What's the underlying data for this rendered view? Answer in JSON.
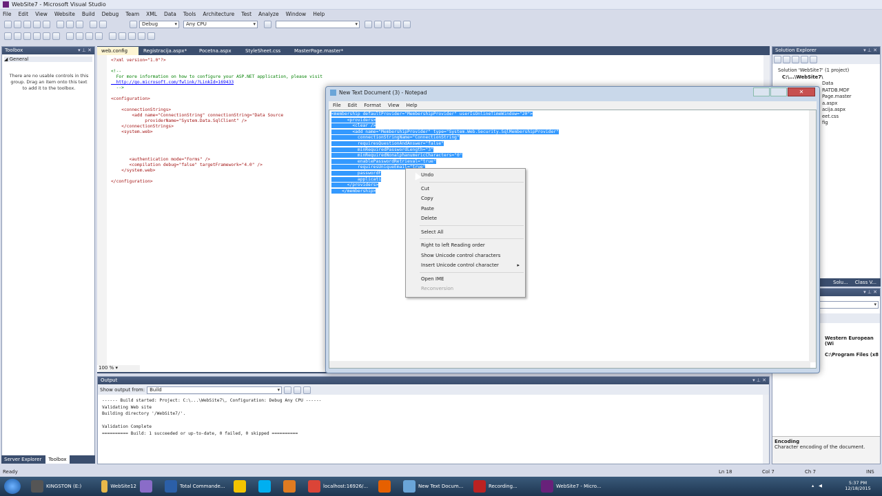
{
  "window": {
    "title": "WebSite7 - Microsoft Visual Studio"
  },
  "menu": [
    "File",
    "Edit",
    "View",
    "Website",
    "Build",
    "Debug",
    "Team",
    "XML",
    "Data",
    "Tools",
    "Architecture",
    "Test",
    "Analyze",
    "Window",
    "Help"
  ],
  "toolbar": {
    "config": "Debug",
    "platform": "Any CPU",
    "search": ""
  },
  "toolbox": {
    "title": "Toolbox",
    "group": "General",
    "empty_text": "There are no usable controls in this group. Drag an item onto this text to add it to the toolbox.",
    "tabs": [
      "Server Explorer",
      "Toolbox"
    ]
  },
  "editor": {
    "tabs": [
      "web.config",
      "Registracija.aspx*",
      "Pocetna.aspx",
      "StyleSheet.css",
      "MasterPage.master*"
    ],
    "lines": [
      "<?xml version=\"1.0\"?>",
      "",
      "<!--",
      "  For more information on how to configure your ASP.NET application, please visit",
      "  http://go.microsoft.com/fwlink/?LinkId=169433",
      "  -->",
      "",
      "<configuration>",
      "",
      "    <connectionStrings>",
      "        <add name=\"ConnectionString\" connectionString=\"Data Source",
      "             providerName=\"System.Data.SqlClient\" />",
      "    </connectionStrings>",
      "    <system.web>",
      "",
      "",
      "",
      "",
      "       <authentication mode=\"Forms\" />",
      "       <compilation debug=\"false\" targetFramework=\"4.0\" />",
      "    </system.web>",
      "",
      "</configuration>"
    ],
    "zoom": "100 %"
  },
  "solution": {
    "title": "Solution Explorer",
    "root": "Solution 'WebSite7' (1 project)",
    "project": "C:\\...\\WebSite7\\",
    "items": [
      "Data",
      "RATDB.MDF",
      "Page.master",
      "a.aspx",
      "acija.aspx",
      "eet.css",
      "fig"
    ],
    "tabs": [
      "Solu...",
      "Class V..."
    ]
  },
  "properties": {
    "encoding_label": "Western European (Wi",
    "path_label": "C:\\Program Files (x8",
    "desc_title": "Encoding",
    "desc_text": "Character encoding of the document."
  },
  "output": {
    "title": "Output",
    "show_label": "Show output from:",
    "source": "Build",
    "lines": [
      "------ Build started: Project: C:\\...\\WebSite7\\, Configuration: Debug Any CPU ------",
      "Validating Web site",
      "Building directory '/WebSite7/'.",
      "",
      "Validation Complete",
      "========== Build: 1 succeeded or up-to-date, 0 failed, 0 skipped =========="
    ]
  },
  "notepad": {
    "title": "New Text Document (3) - Notepad",
    "menu": [
      "File",
      "Edit",
      "Format",
      "View",
      "Help"
    ],
    "lines": [
      "<membership defaultProvider=\"MembershipProvider\" userIsOnlineTimeWindow=\"20\">",
      "      <providers>",
      "        <clear />",
      "        <add name=\"MembershipProvider\" type=\"System.Web.Security.SqlMembershipProvider\"",
      "          connectionStringName=\"ConnectionString\"",
      "          requiresQuestionAndAnswer=\"false\"",
      "          minRequiredPasswordLength=\"3\"",
      "          minRequiredNonalphanumericCharacters=\"0\"",
      "          enablePasswordRetrieval=\"true\"",
      "          requiresUniqueEmail=\"true\"",
      "          passwordF",
      "          applicati",
      "      </providers>",
      "    </membership>"
    ]
  },
  "context_menu": [
    {
      "label": "Undo",
      "enabled": true
    },
    {
      "sep": true
    },
    {
      "label": "Cut",
      "enabled": true
    },
    {
      "label": "Copy",
      "enabled": true
    },
    {
      "label": "Paste",
      "enabled": true
    },
    {
      "label": "Delete",
      "enabled": true
    },
    {
      "sep": true
    },
    {
      "label": "Select All",
      "enabled": true
    },
    {
      "sep": true
    },
    {
      "label": "Right to left Reading order",
      "enabled": true
    },
    {
      "label": "Show Unicode control characters",
      "enabled": true
    },
    {
      "label": "Insert Unicode control character",
      "enabled": true,
      "submenu": true
    },
    {
      "sep": true
    },
    {
      "label": "Open IME",
      "enabled": true
    },
    {
      "label": "Reconversion",
      "enabled": false
    }
  ],
  "status": {
    "left": "Ready",
    "ln": "Ln 18",
    "col": "Col 7",
    "ch": "Ch 7",
    "mode": "INS"
  },
  "taskbar": {
    "items": [
      {
        "label": "KINGSTON (E:)",
        "color": "#555"
      },
      {
        "label": "WebSite12",
        "color": "#e8b84a"
      },
      {
        "label": "",
        "color": "#8a6cc8"
      },
      {
        "label": "Total Commande...",
        "color": "#2b5fa8"
      },
      {
        "label": "",
        "color": "#f4c400"
      },
      {
        "label": "",
        "color": "#00aff0"
      },
      {
        "label": "",
        "color": "#e07b20"
      },
      {
        "label": "localhost:16926/...",
        "color": "#db4437"
      },
      {
        "label": "",
        "color": "#e66000"
      },
      {
        "label": "New Text Docum...",
        "color": "#6aa5d8"
      },
      {
        "label": "Recording...",
        "color": "#b22"
      },
      {
        "label": "WebSite7 - Micro...",
        "color": "#68217a"
      }
    ],
    "clock_time": "5:37 PM",
    "clock_date": "12/18/2015"
  }
}
